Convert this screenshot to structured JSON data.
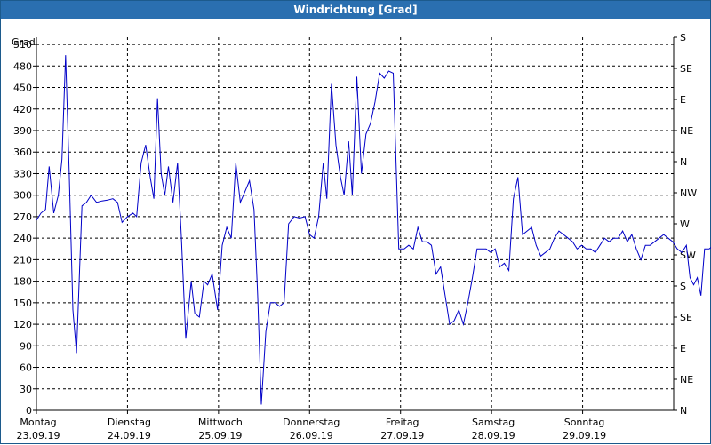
{
  "window": {
    "title": "Windrichtung [Grad]"
  },
  "chart_data": {
    "type": "line",
    "title": "Windrichtung [Grad]",
    "ylabel": "Grad",
    "ylim": [
      0,
      520
    ],
    "yticks": [
      0,
      30,
      60,
      90,
      120,
      150,
      180,
      210,
      240,
      270,
      300,
      330,
      360,
      390,
      420,
      450,
      480,
      510
    ],
    "right_axis_labels": [
      "N",
      "NE",
      "E",
      "SE",
      "S",
      "SW",
      "W",
      "NW",
      "N",
      "NE",
      "E",
      "SE",
      "S"
    ],
    "right_axis_values": [
      0,
      45,
      90,
      135,
      180,
      225,
      270,
      315,
      360,
      405,
      450,
      495,
      540
    ],
    "x_days": [
      {
        "day": "Montag",
        "date": "23.09.19"
      },
      {
        "day": "Dienstag",
        "date": "24.09.19"
      },
      {
        "day": "Mittwoch",
        "date": "25.09.19"
      },
      {
        "day": "Donnerstag",
        "date": "26.09.19"
      },
      {
        "day": "Freitag",
        "date": "27.09.19"
      },
      {
        "day": "Samstag",
        "date": "28.09.19"
      },
      {
        "day": "Sonntag",
        "date": "29.09.19"
      }
    ],
    "xlim": [
      0,
      7
    ],
    "grid": true,
    "series": [
      {
        "color": "#0000c8",
        "points": [
          [
            0.0,
            265
          ],
          [
            0.05,
            275
          ],
          [
            0.1,
            280
          ],
          [
            0.14,
            340
          ],
          [
            0.19,
            275
          ],
          [
            0.24,
            300
          ],
          [
            0.28,
            350
          ],
          [
            0.32,
            495
          ],
          [
            0.36,
            330
          ],
          [
            0.4,
            140
          ],
          [
            0.44,
            80
          ],
          [
            0.5,
            285
          ],
          [
            0.55,
            290
          ],
          [
            0.6,
            300
          ],
          [
            0.66,
            290
          ],
          [
            0.72,
            292
          ],
          [
            0.78,
            293
          ],
          [
            0.84,
            295
          ],
          [
            0.89,
            290
          ],
          [
            0.94,
            262
          ],
          [
            1.0,
            270
          ],
          [
            1.06,
            275
          ],
          [
            1.1,
            270
          ],
          [
            1.15,
            345
          ],
          [
            1.2,
            370
          ],
          [
            1.25,
            325
          ],
          [
            1.29,
            295
          ],
          [
            1.33,
            435
          ],
          [
            1.37,
            330
          ],
          [
            1.41,
            300
          ],
          [
            1.45,
            340
          ],
          [
            1.5,
            290
          ],
          [
            1.55,
            345
          ],
          [
            1.59,
            245
          ],
          [
            1.64,
            100
          ],
          [
            1.7,
            180
          ],
          [
            1.74,
            135
          ],
          [
            1.79,
            130
          ],
          [
            1.84,
            180
          ],
          [
            1.88,
            175
          ],
          [
            1.93,
            190
          ],
          [
            1.99,
            140
          ],
          [
            2.04,
            230
          ],
          [
            2.09,
            255
          ],
          [
            2.14,
            240
          ],
          [
            2.19,
            345
          ],
          [
            2.24,
            290
          ],
          [
            2.29,
            305
          ],
          [
            2.34,
            320
          ],
          [
            2.39,
            280
          ],
          [
            2.43,
            160
          ],
          [
            2.47,
            8
          ],
          [
            2.52,
            110
          ],
          [
            2.57,
            150
          ],
          [
            2.62,
            150
          ],
          [
            2.67,
            145
          ],
          [
            2.72,
            150
          ],
          [
            2.77,
            260
          ],
          [
            2.83,
            270
          ],
          [
            2.89,
            268
          ],
          [
            2.95,
            270
          ],
          [
            3.0,
            245
          ],
          [
            3.05,
            240
          ],
          [
            3.1,
            270
          ],
          [
            3.15,
            345
          ],
          [
            3.19,
            295
          ],
          [
            3.24,
            455
          ],
          [
            3.29,
            370
          ],
          [
            3.34,
            325
          ],
          [
            3.38,
            300
          ],
          [
            3.43,
            375
          ],
          [
            3.47,
            300
          ],
          [
            3.52,
            465
          ],
          [
            3.57,
            330
          ],
          [
            3.62,
            385
          ],
          [
            3.67,
            400
          ],
          [
            3.72,
            430
          ],
          [
            3.77,
            470
          ],
          [
            3.82,
            463
          ],
          [
            3.87,
            473
          ],
          [
            3.92,
            470
          ],
          [
            3.98,
            225
          ],
          [
            4.04,
            225
          ],
          [
            4.09,
            230
          ],
          [
            4.14,
            225
          ],
          [
            4.19,
            255
          ],
          [
            4.24,
            235
          ],
          [
            4.29,
            235
          ],
          [
            4.34,
            230
          ],
          [
            4.39,
            190
          ],
          [
            4.44,
            200
          ],
          [
            4.49,
            160
          ],
          [
            4.54,
            120
          ],
          [
            4.59,
            125
          ],
          [
            4.64,
            140
          ],
          [
            4.69,
            120
          ],
          [
            4.74,
            150
          ],
          [
            4.79,
            185
          ],
          [
            4.84,
            225
          ],
          [
            4.89,
            225
          ],
          [
            4.94,
            225
          ],
          [
            4.99,
            220
          ],
          [
            5.04,
            225
          ],
          [
            5.09,
            200
          ],
          [
            5.14,
            205
          ],
          [
            5.19,
            195
          ],
          [
            5.24,
            295
          ],
          [
            5.29,
            325
          ],
          [
            5.34,
            245
          ],
          [
            5.39,
            250
          ],
          [
            5.44,
            255
          ],
          [
            5.49,
            230
          ],
          [
            5.54,
            215
          ],
          [
            5.59,
            220
          ],
          [
            5.64,
            225
          ],
          [
            5.69,
            240
          ],
          [
            5.74,
            250
          ],
          [
            5.79,
            245
          ],
          [
            5.84,
            240
          ],
          [
            5.89,
            235
          ],
          [
            5.94,
            225
          ],
          [
            5.99,
            230
          ],
          [
            6.04,
            225
          ],
          [
            6.09,
            225
          ],
          [
            6.14,
            220
          ],
          [
            6.19,
            230
          ],
          [
            6.24,
            240
          ],
          [
            6.29,
            235
          ],
          [
            6.34,
            240
          ],
          [
            6.39,
            240
          ],
          [
            6.44,
            250
          ],
          [
            6.49,
            235
          ],
          [
            6.54,
            245
          ],
          [
            6.59,
            225
          ],
          [
            6.64,
            210
          ],
          [
            6.69,
            230
          ],
          [
            6.74,
            230
          ],
          [
            6.79,
            235
          ],
          [
            6.84,
            240
          ],
          [
            6.89,
            245
          ],
          [
            6.94,
            240
          ],
          [
            6.99,
            235
          ],
          [
            7.04,
            225
          ],
          [
            7.09,
            220
          ],
          [
            7.14,
            230
          ],
          [
            7.18,
            185
          ],
          [
            7.22,
            175
          ],
          [
            7.26,
            185
          ],
          [
            7.3,
            160
          ],
          [
            7.34,
            225
          ],
          [
            7.39,
            225
          ],
          [
            7.44,
            230
          ],
          [
            7.49,
            225
          ],
          [
            7.54,
            215
          ],
          [
            7.59,
            220
          ],
          [
            7.64,
            225
          ],
          [
            7.69,
            225
          ],
          [
            7.74,
            230
          ],
          [
            7.79,
            233
          ],
          [
            7.84,
            230
          ],
          [
            7.88,
            220
          ]
        ]
      }
    ]
  }
}
